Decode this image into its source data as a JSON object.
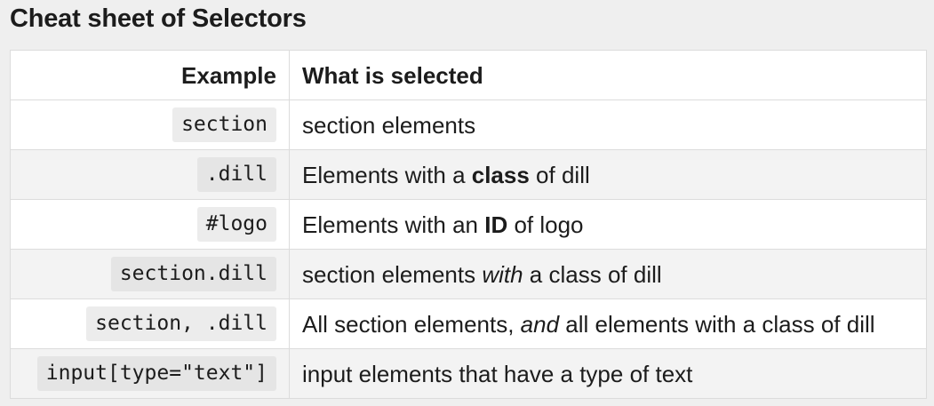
{
  "title": "Cheat sheet of Selectors",
  "table": {
    "headers": {
      "example": "Example",
      "selected": "What is selected"
    },
    "rows": [
      {
        "example": "section",
        "desc": [
          "section elements"
        ]
      },
      {
        "example": ".dill",
        "desc": [
          "Elements with a ",
          "class",
          " of dill"
        ]
      },
      {
        "example": "#logo",
        "desc": [
          "Elements with an ",
          "ID",
          " of logo"
        ]
      },
      {
        "example": "section.dill",
        "desc": [
          "section elements ",
          "with",
          " a class of dill"
        ]
      },
      {
        "example": "section, .dill",
        "desc": [
          "All section elements, ",
          "and",
          " all elements with a class of dill"
        ]
      },
      {
        "example": "input[type=\"text\"]",
        "desc": [
          "input elements that have a type of text"
        ]
      }
    ]
  }
}
